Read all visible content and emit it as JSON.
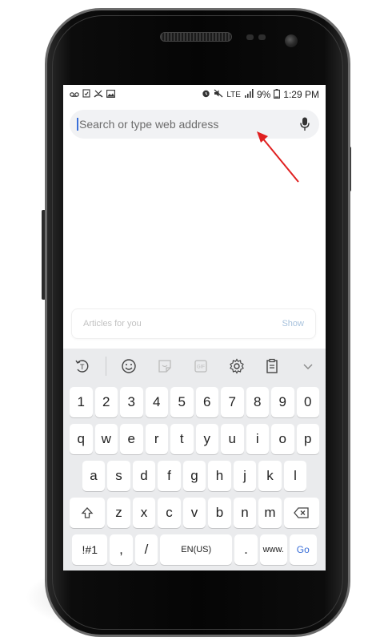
{
  "status_bar": {
    "left_icons": [
      "voicemail-icon",
      "clipboard-check-icon",
      "missed-call-icon",
      "image-icon"
    ],
    "right_icons": [
      "alarm-icon",
      "mute-icon",
      "lte-signal-icon"
    ],
    "network": "LTE",
    "battery": "9%",
    "time": "1:29 PM"
  },
  "address_bar": {
    "placeholder": "Search or type web address",
    "mic_icon": "microphone-icon"
  },
  "articles": {
    "label": "Articles for you",
    "action": "Show"
  },
  "keyboard": {
    "toolbar": [
      "text-translate-icon",
      "emoji-icon",
      "sticker-icon",
      "gif-icon",
      "settings-gear-icon",
      "clipboard-icon",
      "chevron-down-icon"
    ],
    "row_numbers": [
      "1",
      "2",
      "3",
      "4",
      "5",
      "6",
      "7",
      "8",
      "9",
      "0"
    ],
    "row_top": [
      "q",
      "w",
      "e",
      "r",
      "t",
      "y",
      "u",
      "i",
      "o",
      "p"
    ],
    "row_middle": [
      "a",
      "s",
      "d",
      "f",
      "g",
      "h",
      "j",
      "k",
      "l"
    ],
    "row_bottom": [
      "z",
      "x",
      "c",
      "v",
      "b",
      "n",
      "m"
    ],
    "symbols_key": "!#1",
    "comma_key": ",",
    "slash_key": "/",
    "space_label": "EN(US)",
    "period_key": ".",
    "www_key": "www.",
    "go_key": "Go"
  },
  "colors": {
    "accent": "#3a6fd8",
    "annotation_arrow": "#e02020",
    "keyboard_bg": "#eaebed"
  }
}
